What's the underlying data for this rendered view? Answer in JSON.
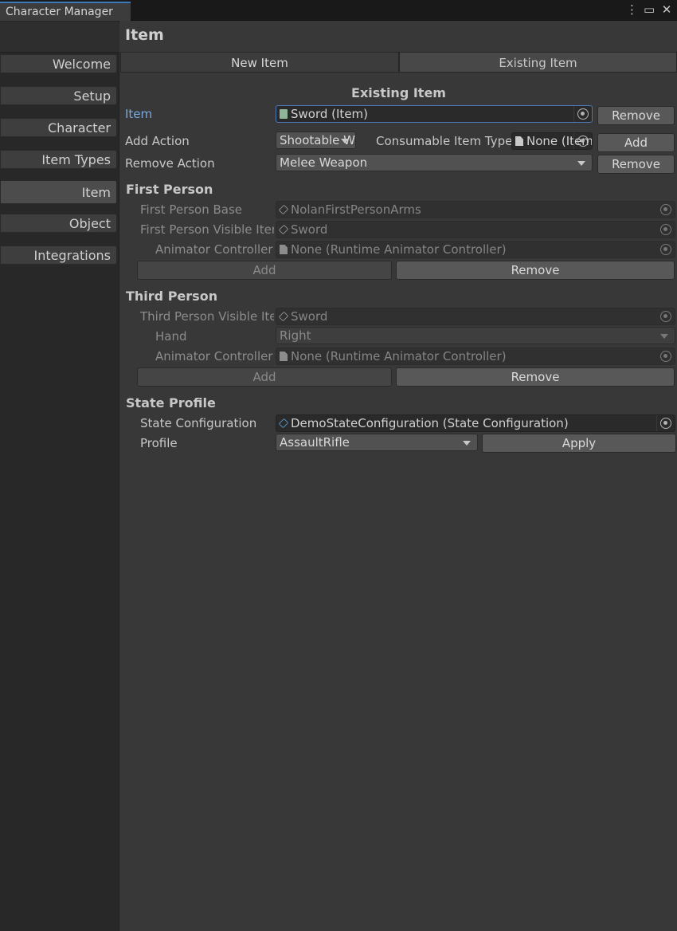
{
  "window": {
    "title": "Character Manager",
    "menu_icon": "kebab-menu-icon",
    "maximize_icon": "maximize-icon",
    "close_icon": "close-icon"
  },
  "sidebar": {
    "items": [
      {
        "label": "Welcome"
      },
      {
        "label": "Setup"
      },
      {
        "label": "Character"
      },
      {
        "label": "Item Types"
      },
      {
        "label": "Item",
        "active": true
      },
      {
        "label": "Object"
      },
      {
        "label": "Integrations"
      }
    ]
  },
  "main": {
    "title": "Item",
    "tabs": [
      {
        "label": "New Item",
        "active": false
      },
      {
        "label": "Existing Item",
        "active": true
      }
    ],
    "section_heading": "Existing Item",
    "item": {
      "label": "Item",
      "value": "Sword (Item)",
      "remove_label": "Remove"
    },
    "add_action": {
      "label": "Add Action",
      "selected": "Shootable Weapon",
      "consumable_label": "Consumable Item Type",
      "consumable_value": "None (Item Type)",
      "add_label": "Add"
    },
    "remove_action": {
      "label": "Remove Action",
      "selected": "Melee Weapon",
      "remove_label": "Remove"
    },
    "first_person": {
      "title": "First Person",
      "base_label": "First Person Base",
      "base_value": "NolanFirstPersonArms",
      "visible_label": "First Person Visible Item",
      "visible_value": "Sword",
      "animator_label": "Animator Controller",
      "animator_value": "None (Runtime Animator Controller)",
      "add_label": "Add",
      "remove_label": "Remove"
    },
    "third_person": {
      "title": "Third Person",
      "visible_label": "Third Person Visible Item",
      "visible_value": "Sword",
      "hand_label": "Hand",
      "hand_value": "Right",
      "animator_label": "Animator Controller",
      "animator_value": "None (Runtime Animator Controller)",
      "add_label": "Add",
      "remove_label": "Remove"
    },
    "state_profile": {
      "title": "State Profile",
      "config_label": "State Configuration",
      "config_value": "DemoStateConfiguration (State Configuration)",
      "profile_label": "Profile",
      "profile_value": "AssaultRifle",
      "apply_label": "Apply"
    }
  },
  "colors": {
    "accent": "#3a79bb",
    "focus_border": "#4d78b7",
    "label_highlight": "#7aa8e0",
    "background": "#383838",
    "sidebar": "#282828"
  }
}
